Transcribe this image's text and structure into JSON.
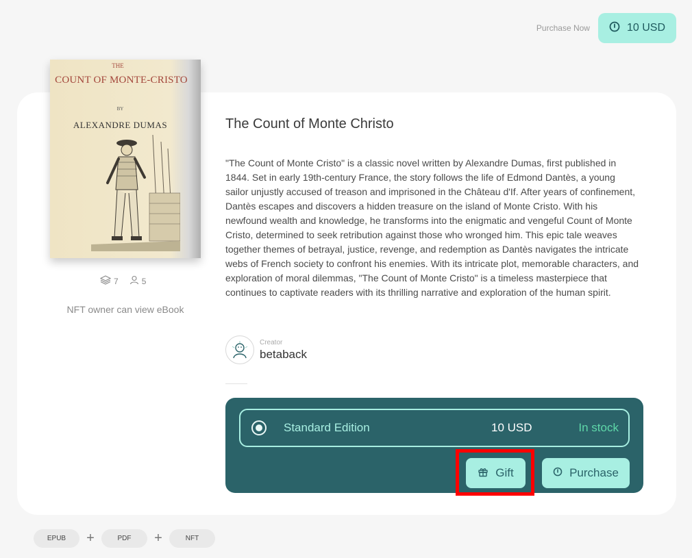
{
  "header": {
    "purchase_label": "Purchase Now",
    "price_button": "10 USD"
  },
  "book": {
    "cover": {
      "the": "THE",
      "title": "COUNT OF MONTE-CRISTO",
      "by": "BY",
      "author": "ALEXANDRE DUMAS"
    },
    "title": "The Count of Monte Christo",
    "description": "\"The Count of Monte Cristo\" is a classic novel written by Alexandre Dumas, first published in 1844. Set in early 19th-century France, the story follows the life of Edmond Dantès, a young sailor unjustly accused of treason and imprisoned in the Château d'If. After years of confinement, Dantès escapes and discovers a hidden treasure on the island of Monte Cristo. With his newfound wealth and knowledge, he transforms into the enigmatic and vengeful Count of Monte Cristo, determined to seek retribution against those who wronged him. This epic tale weaves together themes of betrayal, justice, revenge, and redemption as Dantès navigates the intricate webs of French society to confront his enemies. With its intricate plot, memorable characters, and exploration of moral dilemmas, \"The Count of Monte Cristo\" is a timeless masterpiece that continues to captivate readers with its thrilling narrative and exploration of the human spirit.",
    "stats": {
      "layers_icon": "layers-icon",
      "layers_count": "7",
      "owners_icon": "user-icon",
      "owners_count": "5"
    },
    "owner_note": "NFT owner can view eBook"
  },
  "creator": {
    "label": "Creator",
    "name": "betaback"
  },
  "edition": {
    "name": "Standard Edition",
    "price": "10 USD",
    "stock": "In stock",
    "gift_label": "Gift",
    "purchase_label": "Purchase"
  },
  "formats": [
    "EPUB",
    "PDF",
    "NFT"
  ],
  "formats_separator": "+",
  "colors": {
    "accent": "#a8efe2",
    "panel": "#2b6369",
    "stock": "#5fd8a9",
    "highlight": "#ff0000"
  }
}
